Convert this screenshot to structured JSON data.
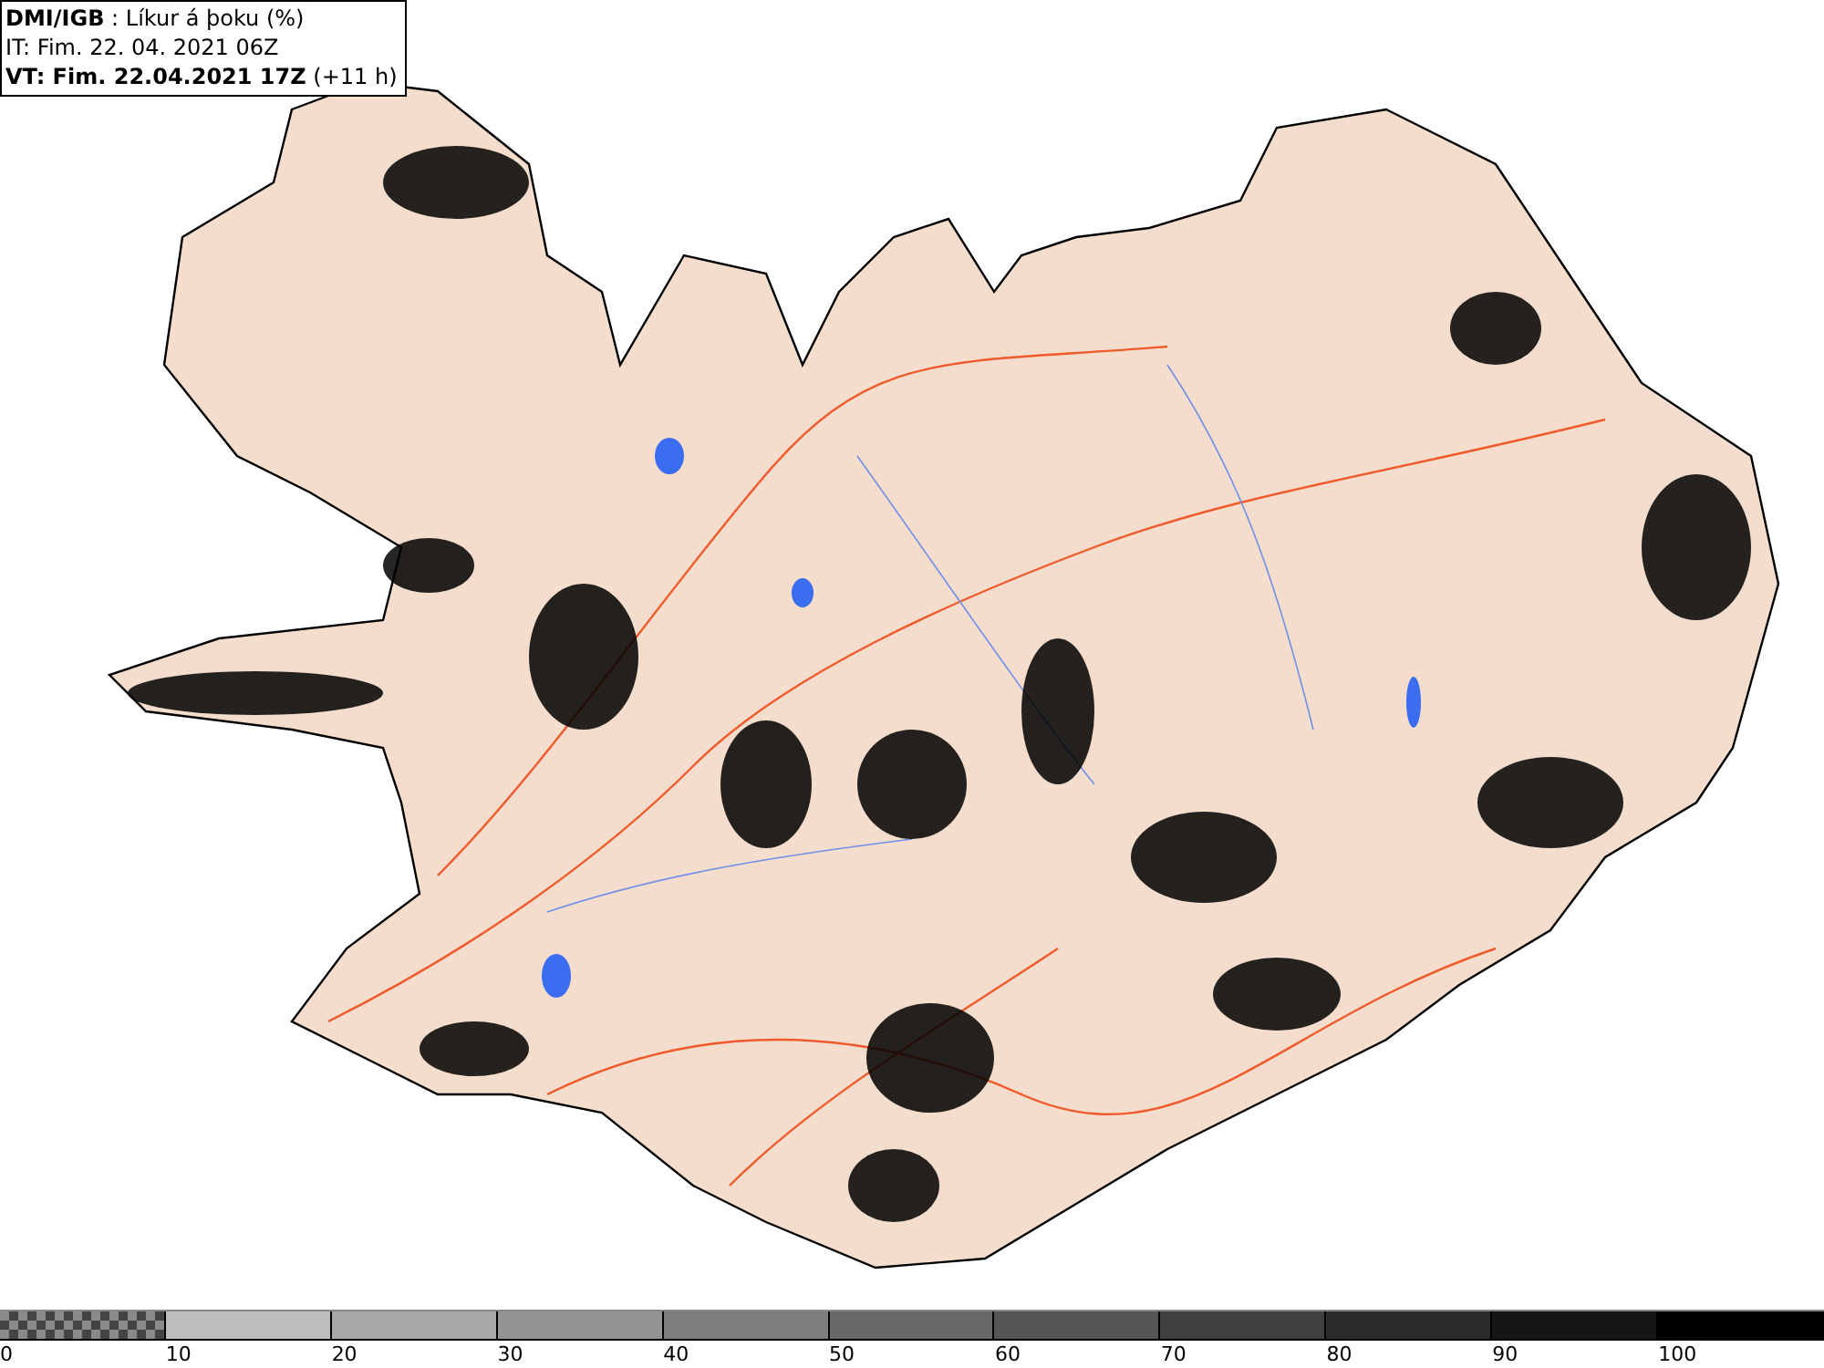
{
  "info_box": {
    "lines": [
      "**DMI/IGB** : Líkur á þoku (%)",
      "IT: Fim. 22. 04. 2021 06Z",
      "**VT: Fim. 22.04.2021 17Z** (+11 h)"
    ]
  },
  "legend": [
    {
      "label": "0",
      "kind": "checker"
    },
    {
      "label": "10",
      "kind": "solid",
      "color": "#bdbdbd"
    },
    {
      "label": "20",
      "kind": "solid",
      "color": "#a8a8a8"
    },
    {
      "label": "30",
      "kind": "solid",
      "color": "#939393"
    },
    {
      "label": "40",
      "kind": "solid",
      "color": "#7e7e7e"
    },
    {
      "label": "50",
      "kind": "solid",
      "color": "#696969"
    },
    {
      "label": "60",
      "kind": "solid",
      "color": "#555555"
    },
    {
      "label": "70",
      "kind": "solid",
      "color": "#404040"
    },
    {
      "label": "80",
      "kind": "solid",
      "color": "#2b2b2b"
    },
    {
      "label": "90",
      "kind": "solid",
      "color": "#161616"
    },
    {
      "label": "100",
      "kind": "solid",
      "color": "#000000"
    }
  ]
}
